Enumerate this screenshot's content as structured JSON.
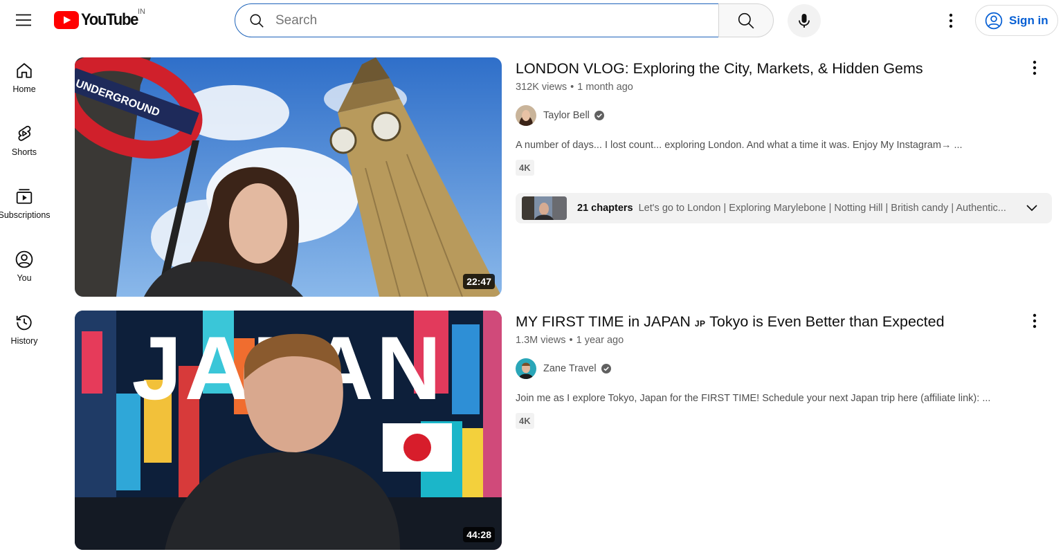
{
  "header": {
    "logo_text": "YouTube",
    "country_code": "IN",
    "search_placeholder": "Search",
    "signin_label": "Sign in"
  },
  "sidebar": {
    "items": [
      {
        "label": "Home",
        "icon": "home-icon"
      },
      {
        "label": "Shorts",
        "icon": "shorts-icon"
      },
      {
        "label": "Subscriptions",
        "icon": "subscriptions-icon"
      },
      {
        "label": "You",
        "icon": "you-icon"
      },
      {
        "label": "History",
        "icon": "history-icon"
      }
    ]
  },
  "videos": [
    {
      "title": "LONDON VLOG: Exploring the City, Markets, & Hidden Gems",
      "views": "312K views",
      "age": "1 month ago",
      "channel": "Taylor Bell",
      "description": "A number of days... I lost count... exploring London. And what a time it was. Enjoy My Instagram→ ...",
      "badge": "4K",
      "duration": "22:47",
      "chapters_count": "21 chapters",
      "chapters_text": "Let's go to London | Exploring Marylebone | Notting Hill | British candy | Authentic...",
      "thumb_sign_text": "UNDERGROUND"
    },
    {
      "title_main": "MY FIRST TIME in JAPAN",
      "title_flag": "JP",
      "title_rest": "Tokyo is Even Better than Expected",
      "views": "1.3M views",
      "age": "1 year ago",
      "channel": "Zane Travel",
      "description": "Join me as I explore Tokyo, Japan for the FIRST TIME! Schedule your next Japan trip here (affiliate link): ...",
      "badge": "4K",
      "duration": "44:28",
      "thumb_overlay_text": "JAPAN"
    }
  ],
  "colors": {
    "brand_red": "#ff0000",
    "link_blue": "#065fd4",
    "search_border": "#1c62b9"
  }
}
